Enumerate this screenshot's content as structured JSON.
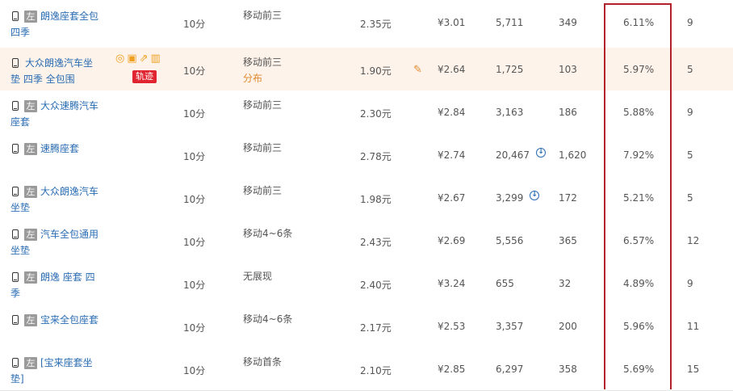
{
  "rows": [
    {
      "keyword": "朗逸座套全包 四季",
      "has_tag": true,
      "time": "10分",
      "rank": "移动前三",
      "rank_sub": "",
      "bid": "2.35元",
      "price": "¥3.01",
      "num1": "5,711",
      "num2": "349",
      "rate": "6.11%",
      "last": "9"
    },
    {
      "keyword": "大众朗逸汽车坐垫 四季 全包围",
      "has_tag": false,
      "time": "10分",
      "rank": "移动前三",
      "rank_sub": "分布",
      "bid": "1.90元",
      "price": "¥2.64",
      "num1": "1,725",
      "num2": "103",
      "rate": "5.97%",
      "last": "5",
      "highlight": true,
      "track_label": "轨迹"
    },
    {
      "keyword": "大众速腾汽车座套",
      "has_tag": true,
      "time": "10分",
      "rank": "移动前三",
      "rank_sub": "",
      "bid": "2.30元",
      "price": "¥2.84",
      "num1": "3,163",
      "num2": "186",
      "rate": "5.88%",
      "last": "9"
    },
    {
      "keyword": "速腾座套",
      "has_tag": true,
      "time": "10分",
      "rank": "移动前三",
      "rank_sub": "",
      "bid": "2.78元",
      "price": "¥2.74",
      "num1": "20,467",
      "num2": "1,620",
      "rate": "7.92%",
      "last": "5",
      "download": true
    },
    {
      "keyword": "大众朗逸汽车坐垫",
      "has_tag": true,
      "time": "10分",
      "rank": "移动前三",
      "rank_sub": "",
      "bid": "1.98元",
      "price": "¥2.67",
      "num1": "3,299",
      "num2": "172",
      "rate": "5.21%",
      "last": "5",
      "download": true
    },
    {
      "keyword": "汽车全包通用坐垫",
      "has_tag": true,
      "time": "10分",
      "rank": "移动4~6条",
      "rank_sub": "",
      "bid": "2.43元",
      "price": "¥2.69",
      "num1": "5,556",
      "num2": "365",
      "rate": "6.57%",
      "last": "12"
    },
    {
      "keyword": "朗逸 座套 四季",
      "has_tag": true,
      "time": "10分",
      "rank": "无展现",
      "rank_sub": "",
      "bid": "2.40元",
      "price": "¥3.24",
      "num1": "655",
      "num2": "32",
      "rate": "4.89%",
      "last": "9"
    },
    {
      "keyword": "宝来全包座套",
      "has_tag": true,
      "time": "10分",
      "rank": "移动4~6条",
      "rank_sub": "",
      "bid": "2.17元",
      "price": "¥2.53",
      "num1": "3,357",
      "num2": "200",
      "rate": "5.96%",
      "last": "11"
    },
    {
      "keyword": "[宝来座套坐垫]",
      "has_tag": true,
      "time": "10分",
      "rank": "移动首条",
      "rank_sub": "",
      "bid": "2.10元",
      "price": "¥2.85",
      "num1": "6,297",
      "num2": "358",
      "rate": "5.69%",
      "last": "15"
    }
  ],
  "tag_label": "左",
  "colors": {
    "link": "#2a6cb3",
    "highlight_row": "#fdf3ea",
    "red_box": "#b3222a",
    "accent_orange": "#e08a2e"
  }
}
